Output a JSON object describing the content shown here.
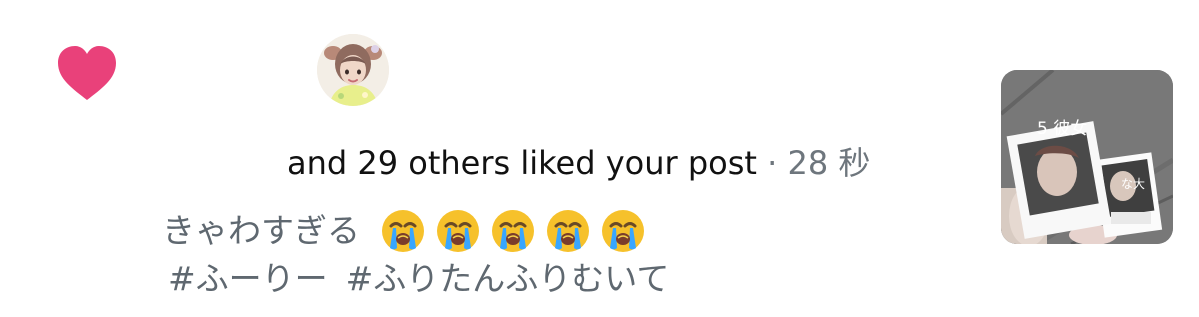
{
  "notification": {
    "activity_text": "and 29 others liked your post",
    "separator": "·",
    "timestamp": "28 秒",
    "comment_text": "きゃわすぎる",
    "comment_emojis": [
      "loudly-crying-face",
      "loudly-crying-face",
      "loudly-crying-face",
      "loudly-crying-face",
      "loudly-crying-face"
    ],
    "hashtags": [
      "#ふーりー",
      "#ふりたんふりむいて"
    ],
    "thumbnail_caption": "5 彼女",
    "thumbnail_note": "な大"
  },
  "icons": {
    "heart": "heart-icon",
    "emoji": "loudly-crying-face-emoji"
  },
  "colors": {
    "heart": "#e9417a",
    "secondary_text": "#6e767d",
    "comment_text": "#5f6870"
  }
}
